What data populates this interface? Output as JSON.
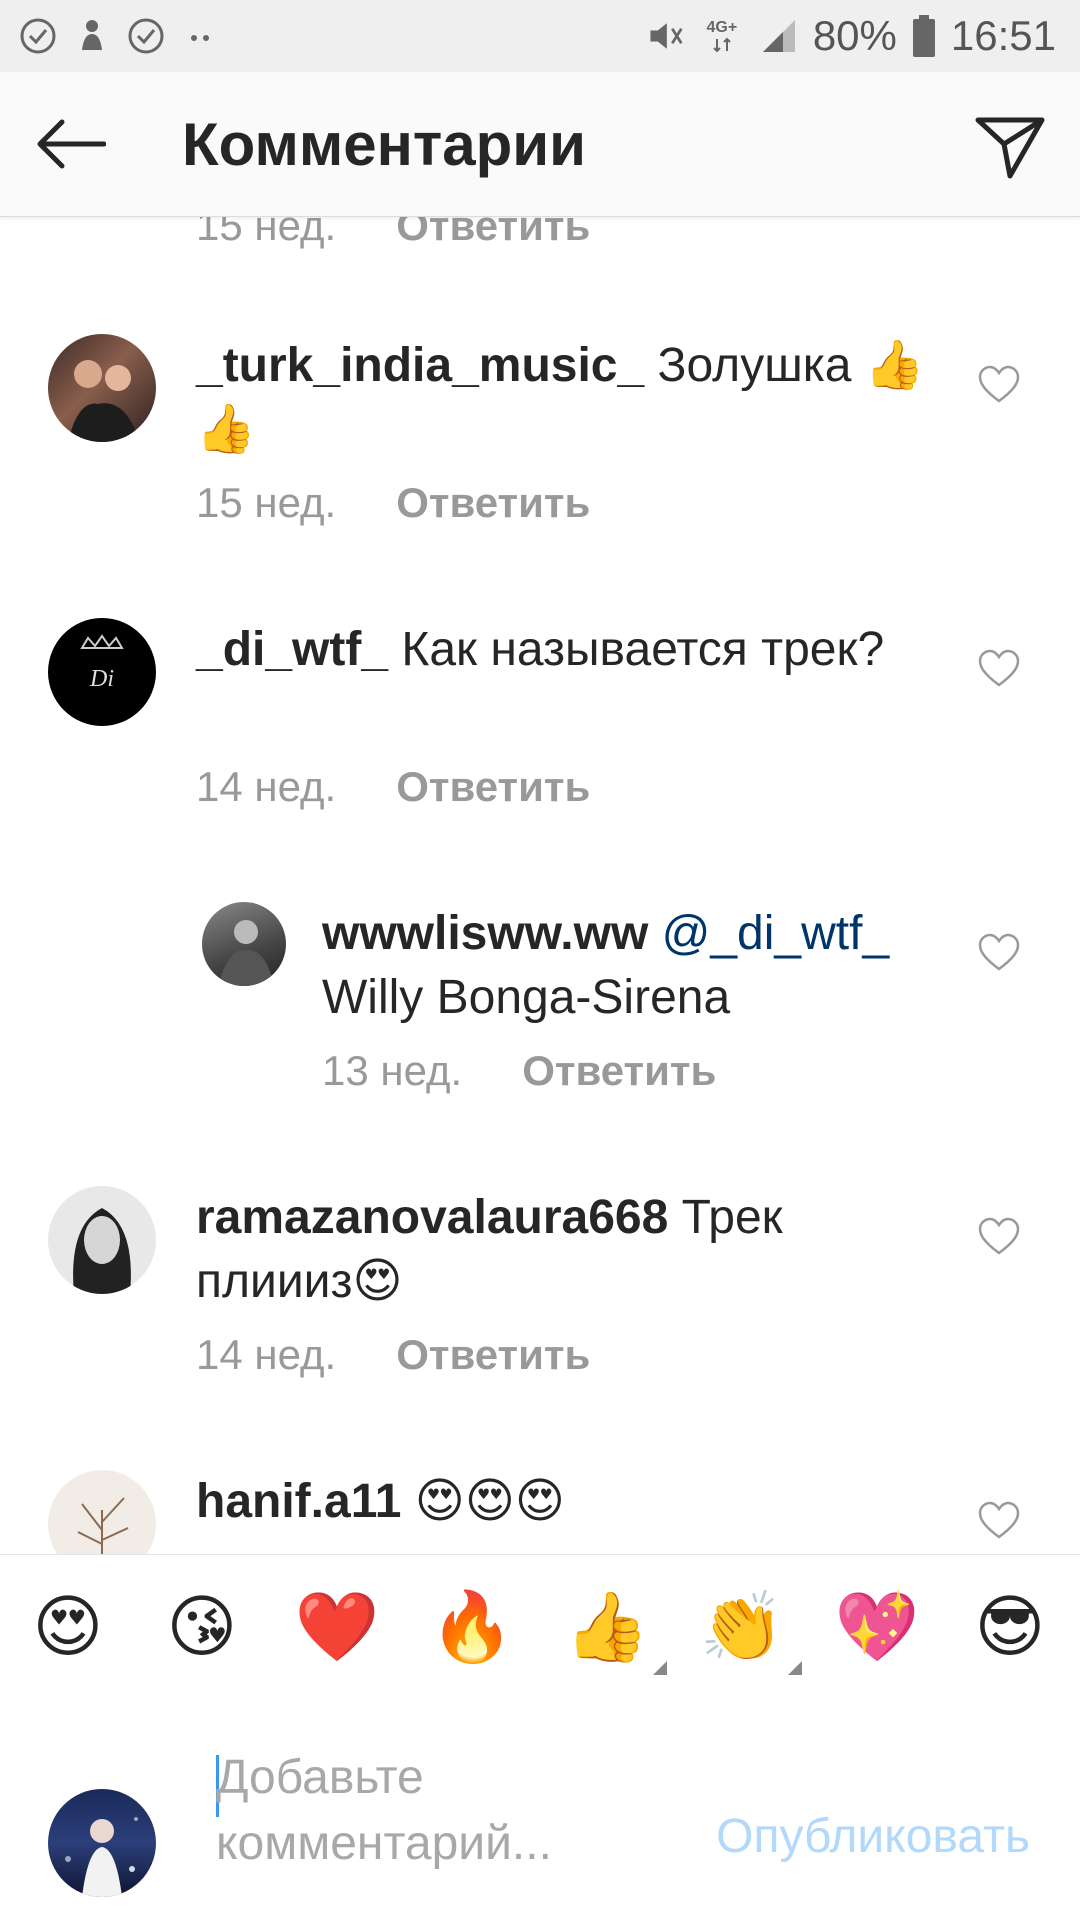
{
  "status_bar": {
    "battery": "80%",
    "time": "16:51",
    "network": "4G+"
  },
  "header": {
    "title": "Комментарии"
  },
  "comments": [
    {
      "time": "15 нед.",
      "reply": "Ответить"
    },
    {
      "username": "_turk_india_music_",
      "text": "Золушка 👍👍",
      "time": "15 нед.",
      "reply": "Ответить"
    },
    {
      "username": "_di_wtf_",
      "text": "Как называется трек?",
      "time": "14 нед.",
      "reply": "Ответить",
      "avatar_text": "Di"
    },
    {
      "username": "wwwlisww.ww",
      "mention": "@_di_wtf_",
      "text": "Willy Bonga-Sirena",
      "time": "13 нед.",
      "reply": "Ответить"
    },
    {
      "username": "ramazanovalaura668",
      "text": "Трек плиииз😍",
      "time": "14 нед.",
      "reply": "Ответить"
    },
    {
      "username": "hanif.a11",
      "text": "😍😍😍"
    }
  ],
  "emoji_bar": [
    "😍",
    "😘",
    "❤️",
    "🔥",
    "👍",
    "👏",
    "💖",
    "😎"
  ],
  "composer": {
    "placeholder": "Добавьте комментарий...",
    "publish_label": "Опубликовать"
  },
  "colors": {
    "link": "#003569",
    "publish_disabled": "#b2d8fb",
    "meta": "#999999"
  }
}
